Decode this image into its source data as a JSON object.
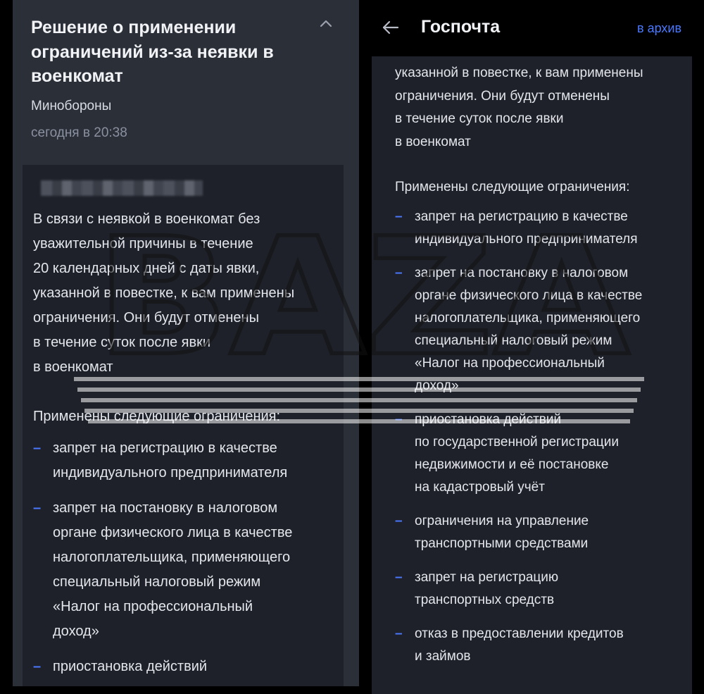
{
  "left": {
    "title": "Решение о применении ограничений из-за неявки в военкомат",
    "sender": "Минобороны",
    "date": "сегодня в 20:38",
    "intro": "В связи с неявкой в военкомат без\nуважительной причины в течение\n20 календарных дней с даты явки,\nуказанной в повестке, к вам применены\nограничения. Они будут отменены\nв течение суток после явки\nв военкомат",
    "restrictions_header": "Применены следующие ограничения:",
    "items": [
      "запрет на регистрацию в качестве\nиндивидуального предпринимателя",
      "запрет на постановку в налоговом\nоргане физического лица в качестве\nналогоплательщика, применяющего\nспециальный налоговый режим\n«Налог на профессиональный\nдоход»",
      "приостановка действий"
    ]
  },
  "right": {
    "header_title": "Госпочта",
    "archive_label": "в архив",
    "intro": "указанной в повестке, к вам применены\nограничения. Они будут отменены\nв течение суток после явки\nв военкомат",
    "restrictions_header": "Применены следующие ограничения:",
    "items": [
      "запрет на регистрацию в качестве\nиндивидуального предпринимателя",
      "запрет на постановку в налоговом\nоргане физического лица в качестве\nналогоплательщика, применяющего\nспециальный налоговый режим\n«Налог на профессиональный\nдоход»",
      "приостановка действий\nпо государственной регистрации\nнедвижимости и её постановке\nна кадастровый учёт",
      "ограничения на управление\nтранспортными средствами",
      "запрет на регистрацию\nтранспортных средств",
      "отказ в предоставлении кредитов\nи займов"
    ]
  },
  "list_marker": "–",
  "watermark": "BAZA",
  "colors": {
    "accent": "#4a79ff",
    "panel": "#2b2f38",
    "card": "#1e2129",
    "background": "#000000"
  },
  "icons": {
    "collapse": "chevron-up-icon",
    "back": "arrow-left-icon"
  }
}
